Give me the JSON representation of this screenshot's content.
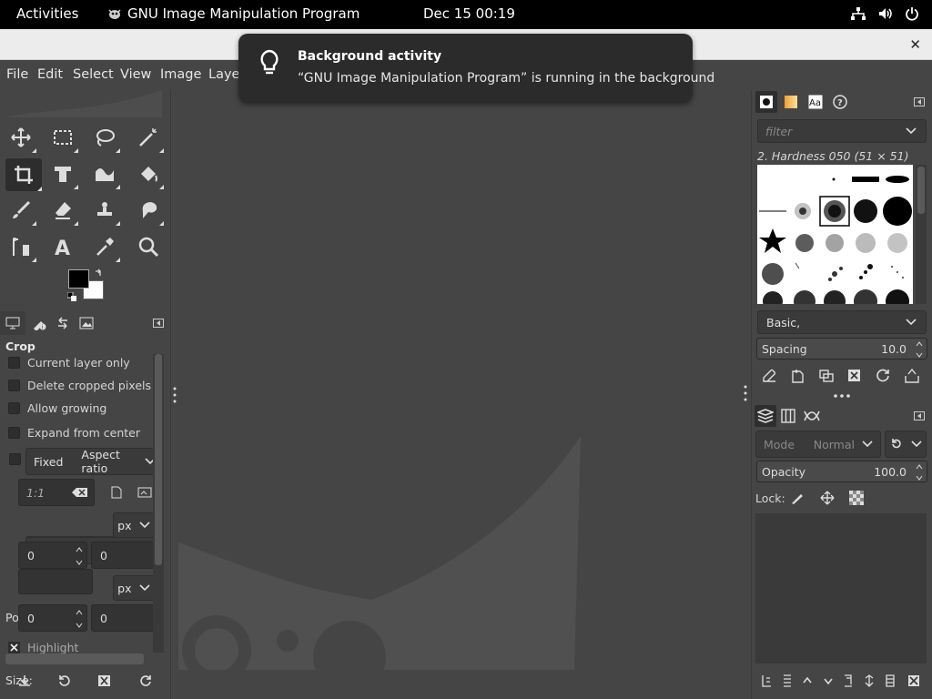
{
  "topbar": {
    "activities": "Activities",
    "app_name": "GNU Image Manipulation Program",
    "clock": "Dec 15  00:19"
  },
  "menubar": {
    "items": [
      "File",
      "Edit",
      "Select",
      "View",
      "Image",
      "Layer"
    ]
  },
  "notification": {
    "title": "Background activity",
    "body": "“GNU Image Manipulation Program” is running in the background"
  },
  "tool_options": {
    "title": "Crop",
    "current_layer_only": "Current layer only",
    "delete_cropped": "Delete cropped pixels",
    "allow_growing": "Allow growing",
    "expand_center": "Expand from center",
    "fixed": "Fixed",
    "aspect": "Aspect ratio",
    "ratio_value": "1:1",
    "position_label": "Position:",
    "position_unit": "px",
    "pos_x": "0",
    "pos_y": "0",
    "size_label": "Size:",
    "size_unit": "px",
    "size_w": "0",
    "size_h": "0",
    "highlight": "Highlight"
  },
  "brushes": {
    "filter_placeholder": "filter",
    "selected": "2. Hardness 050 (51 × 51)",
    "tag": "Basic,",
    "spacing_label": "Spacing",
    "spacing_value": "10.0"
  },
  "layers": {
    "mode_label": "Mode",
    "mode_value": "Normal",
    "opacity_label": "Opacity",
    "opacity_value": "100.0",
    "lock_label": "Lock:"
  },
  "colors": {
    "fg": "#000000",
    "bg": "#ffffff",
    "dark": "#2b2b2b"
  }
}
